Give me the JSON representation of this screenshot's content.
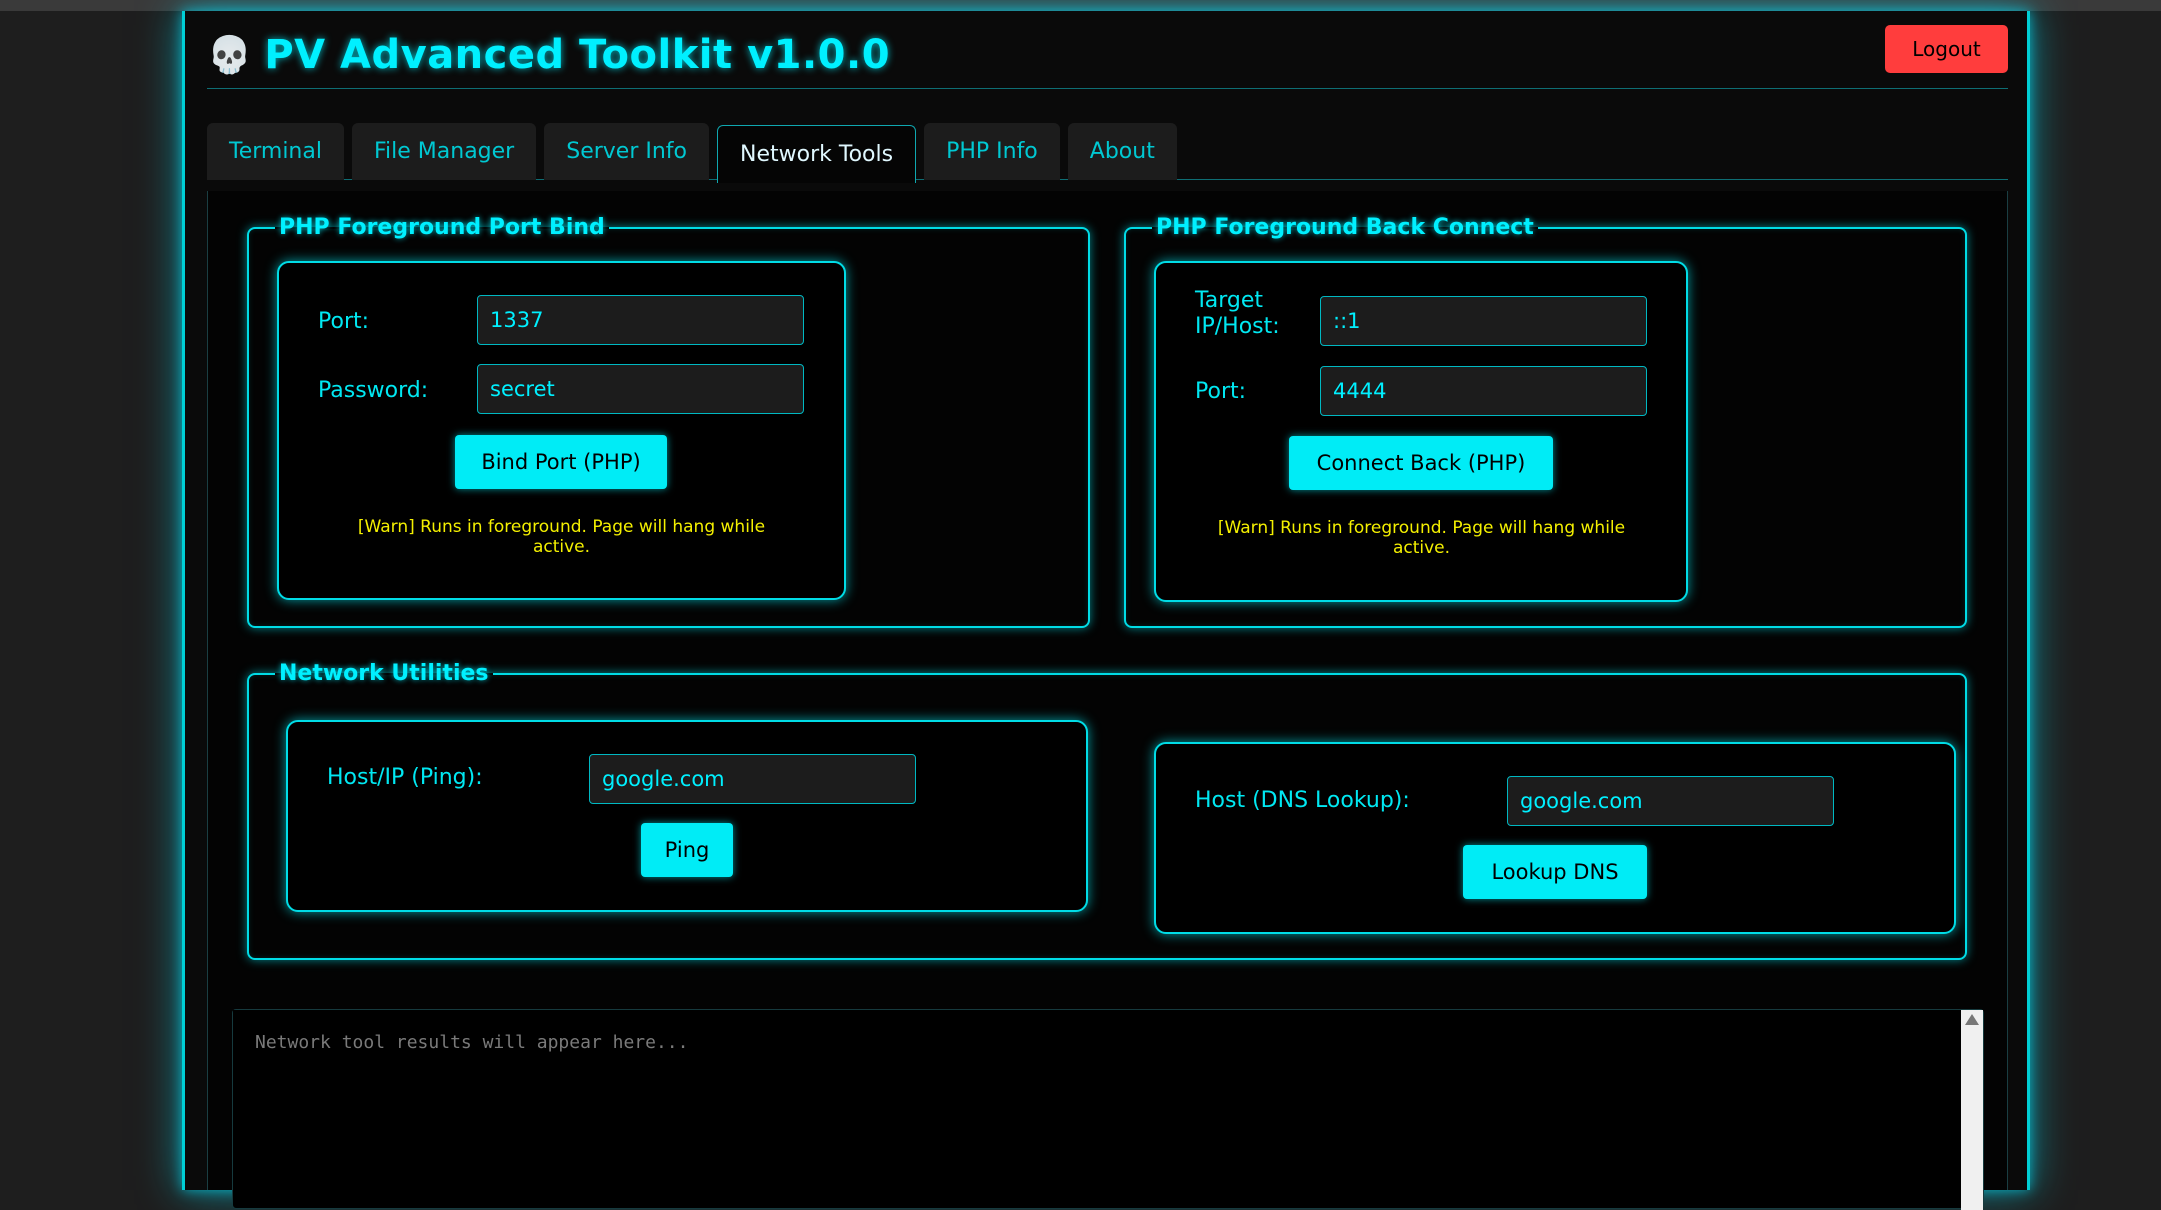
{
  "app": {
    "title": "PV Advanced Toolkit v1.0.0",
    "skull": "💀",
    "logout_label": "Logout"
  },
  "tabs": [
    {
      "label": "Terminal",
      "active": false
    },
    {
      "label": "File Manager",
      "active": false
    },
    {
      "label": "Server Info",
      "active": false
    },
    {
      "label": "Network Tools",
      "active": true
    },
    {
      "label": "PHP Info",
      "active": false
    },
    {
      "label": "About",
      "active": false
    }
  ],
  "bind": {
    "legend": "PHP Foreground Port Bind",
    "port_label": "Port:",
    "port_value": "1337",
    "password_label": "Password:",
    "password_value": "secret",
    "button": "Bind Port (PHP)",
    "warn": "[Warn] Runs in foreground. Page will hang while active."
  },
  "backconnect": {
    "legend": "PHP Foreground Back Connect",
    "target_label": "Target IP/Host:",
    "target_value": "::1",
    "port_label": "Port:",
    "port_value": "4444",
    "button": "Connect Back (PHP)",
    "warn": "[Warn] Runs in foreground. Page will hang while active."
  },
  "utilities": {
    "legend": "Network Utilities",
    "ping_label": "Host/IP (Ping):",
    "ping_value": "google.com",
    "ping_button": "Ping",
    "dns_label": "Host (DNS Lookup):",
    "dns_value": "google.com",
    "dns_button": "Lookup DNS"
  },
  "output": {
    "placeholder": "Network tool results will appear here..."
  },
  "colors": {
    "accent": "#00f0ff",
    "logout": "#ff3d3d",
    "warn": "#f4f000"
  }
}
